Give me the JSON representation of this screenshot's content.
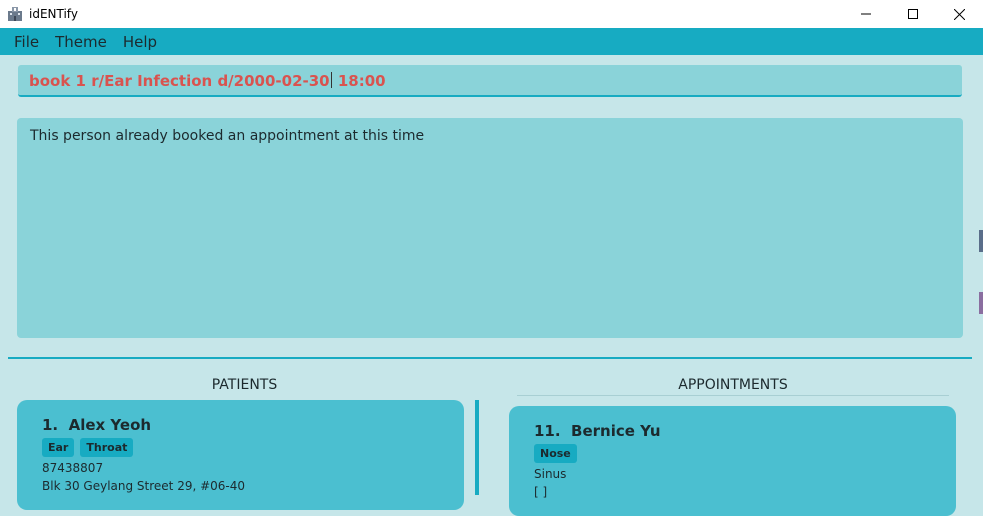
{
  "window": {
    "title": "idENTify",
    "icon": "hospital-icon",
    "controls": [
      "minimize-icon",
      "maximize-icon",
      "close-icon"
    ]
  },
  "menu": {
    "items": [
      "File",
      "Theme",
      "Help"
    ]
  },
  "command": {
    "before_caret": "book 1 r/Ear Infection d/2000-02-30",
    "after_caret": " 18:00"
  },
  "result": {
    "message": "This person already booked an appointment at this time"
  },
  "patients": {
    "title": "PATIENTS",
    "cards": [
      {
        "index": "1.",
        "name": "Alex Yeoh",
        "tags": [
          "Ear",
          "Throat"
        ],
        "phone": "87438807",
        "address": "Blk 30 Geylang Street 29, #06-40"
      }
    ]
  },
  "appointments": {
    "title": "APPOINTMENTS",
    "cards": [
      {
        "index": "11.",
        "name": "Bernice Yu",
        "tags": [
          "Nose"
        ],
        "reason": "Sinus",
        "extra": "[ ]"
      }
    ]
  },
  "colors": {
    "accent": "#17abc2",
    "panel": "#8ad3d9",
    "card": "#4bbfd0",
    "background": "#c6e6e9",
    "command_text": "#d9534f"
  }
}
